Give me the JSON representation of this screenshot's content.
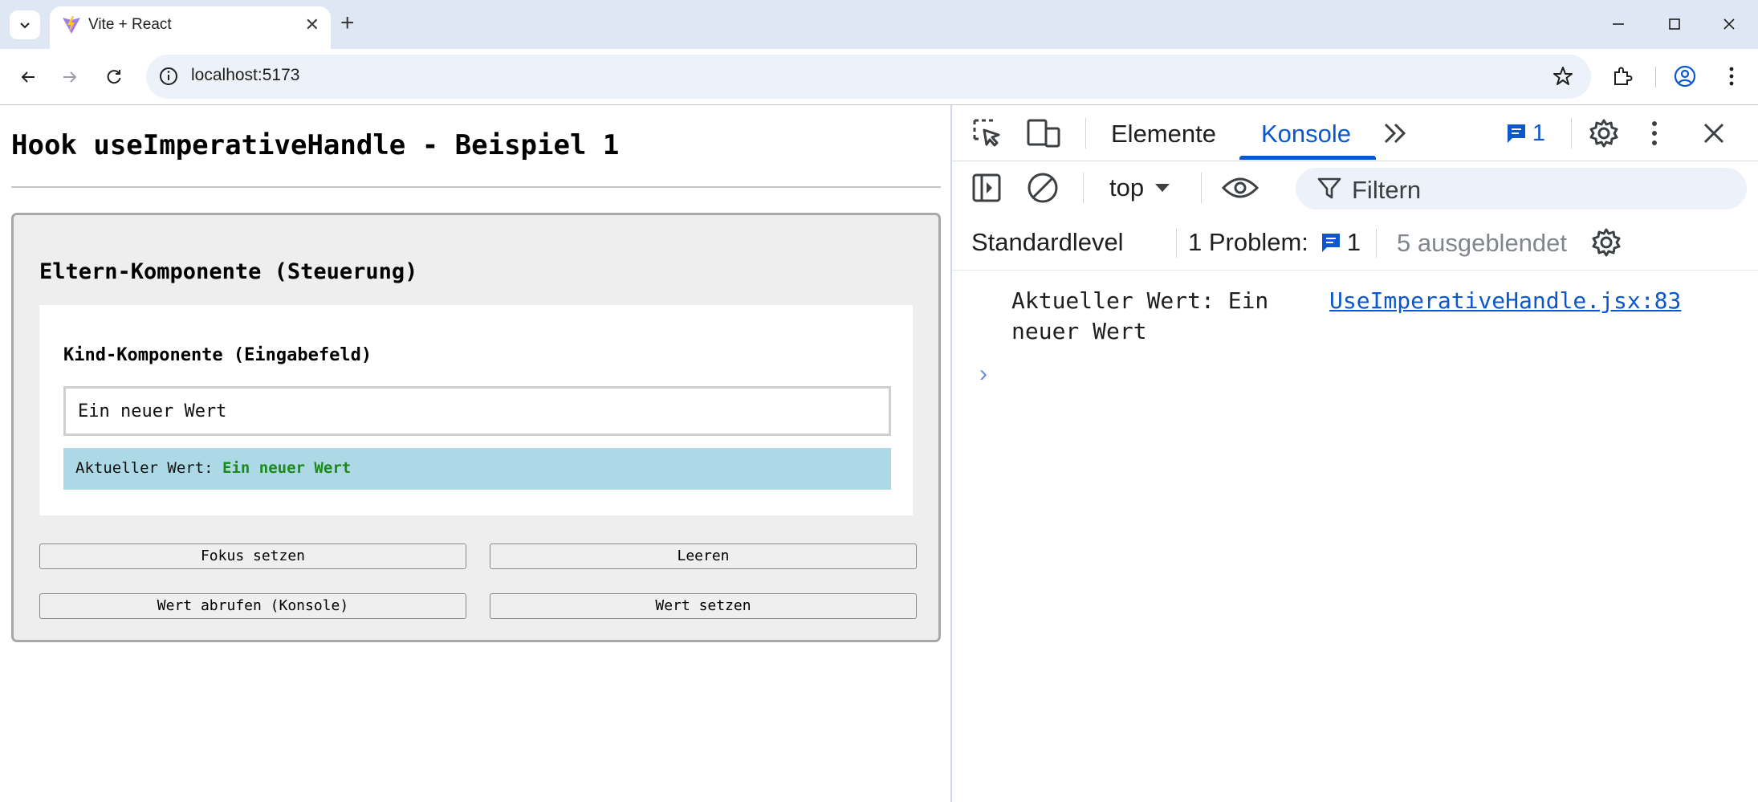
{
  "browser": {
    "tab_title": "Vite + React",
    "url": "localhost:5173",
    "accent": "#dfe6f4"
  },
  "page": {
    "heading": "Hook useImperativeHandle - Beispiel 1",
    "parent_title": "Eltern-Komponente (Steuerung)",
    "child_title": "Kind-Komponente (Eingabefeld)",
    "input_value": "Ein neuer Wert",
    "status_label": "Aktueller Wert:",
    "status_value": "Ein neuer Wert",
    "buttons": {
      "focus": "Fokus setzen",
      "clear": "Leeren",
      "get_value": "Wert abrufen (Konsole)",
      "set_value": "Wert setzen"
    }
  },
  "devtools": {
    "tabs": [
      "Elemente",
      "Konsole"
    ],
    "active_tab": "Konsole",
    "issues_count": "1",
    "context": "top",
    "filter_placeholder": "Filtern",
    "log_level": "Standardlevel",
    "problems_label": "1 Problem:",
    "problems_count": "1",
    "hidden_label": "5 ausgeblendet",
    "console_message": "Aktueller Wert: Ein neuer Wert",
    "console_source": "UseImperativeHandle.jsx:83",
    "accent": "#0b57d0"
  }
}
